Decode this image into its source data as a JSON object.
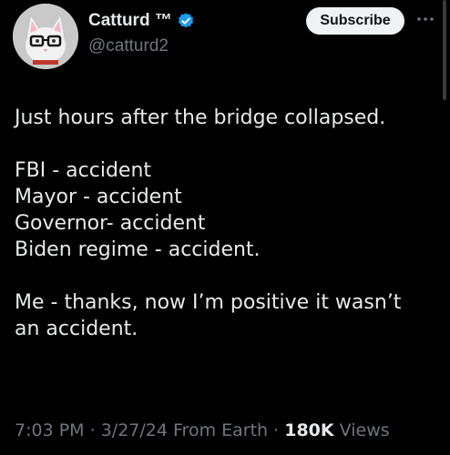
{
  "author": {
    "display_name": "Catturd ™",
    "handle": "@catturd2",
    "verified_color": "#1d9bf0"
  },
  "actions": {
    "subscribe_label": "Subscribe",
    "more_icon": "more-horizontal-icon"
  },
  "tweet": {
    "lines": [
      "Just hours after the bridge collapsed.",
      "",
      "FBI - accident",
      "Mayor - accident",
      "Governor- accident",
      "Biden regime - accident.",
      "",
      "Me - thanks, now I’m positive it wasn’t",
      "an accident."
    ]
  },
  "meta": {
    "time": "7:03 PM",
    "separator": "·",
    "date": "3/27/24",
    "source": "From Earth",
    "views_count": "180K",
    "views_label": "Views"
  },
  "colors": {
    "background": "#000000",
    "text_primary": "#e7e9ea",
    "text_secondary": "#71767b",
    "button_bg": "#eff3f4"
  }
}
